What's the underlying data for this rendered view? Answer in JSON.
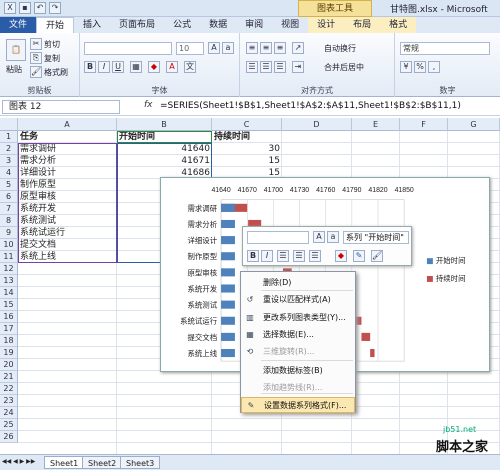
{
  "titlebar": {
    "context_tools": "图表工具",
    "doc_title": "甘特图.xlsx - Microsoft"
  },
  "tabs": [
    {
      "label": "文件",
      "kind": "file"
    },
    {
      "label": "开始",
      "kind": "active"
    },
    {
      "label": "插入",
      "kind": ""
    },
    {
      "label": "页面布局",
      "kind": ""
    },
    {
      "label": "公式",
      "kind": ""
    },
    {
      "label": "数据",
      "kind": ""
    },
    {
      "label": "审阅",
      "kind": ""
    },
    {
      "label": "视图",
      "kind": ""
    },
    {
      "label": "设计",
      "kind": "ctx"
    },
    {
      "label": "布局",
      "kind": "ctx"
    },
    {
      "label": "格式",
      "kind": "ctx"
    }
  ],
  "ribbon": {
    "paste": "粘贴",
    "cut": "剪切",
    "copy": "复制",
    "format_painter": "格式刷",
    "clipboard_group": "剪贴板",
    "font_size": "10",
    "font_group": "字体",
    "align_group": "对齐方式",
    "wrap": "自动换行",
    "merge": "合并后居中",
    "number_format": "常规",
    "number_group": "数字",
    "bold": "B",
    "italic": "I",
    "underline": "U"
  },
  "formula_bar": {
    "name_box": "图表 12",
    "fx": "fx",
    "formula": "=SERIES(Sheet1!$B$1,Sheet1!$A$2:$A$11,Sheet1!$B$2:$B$11,1)"
  },
  "columns": [
    "A",
    "B",
    "C",
    "D",
    "E",
    "F",
    "G"
  ],
  "rows": [
    "1",
    "2",
    "3",
    "4",
    "5",
    "6",
    "7",
    "8",
    "9",
    "10",
    "11",
    "12",
    "13",
    "14",
    "15",
    "16",
    "17",
    "18",
    "19",
    "20",
    "21",
    "22",
    "23",
    "24",
    "25",
    "26"
  ],
  "header": {
    "task": "任务",
    "start": "开始时间",
    "duration": "持续时间"
  },
  "tasks": [
    {
      "name": "需求调研",
      "start": "41640",
      "dur": "30"
    },
    {
      "name": "需求分析",
      "start": "41671",
      "dur": "15"
    },
    {
      "name": "详细设计",
      "start": "41686",
      "dur": "15"
    },
    {
      "name": "制作原型",
      "start": "",
      "dur": ""
    },
    {
      "name": "原型审核",
      "start": "",
      "dur": ""
    },
    {
      "name": "系统开发",
      "start": "",
      "dur": ""
    },
    {
      "name": "系统测试",
      "start": "",
      "dur": ""
    },
    {
      "name": "系统试运行",
      "start": "",
      "dur": ""
    },
    {
      "name": "提交文档",
      "start": "",
      "dur": ""
    },
    {
      "name": "系统上线",
      "start": "",
      "dur": ""
    }
  ],
  "chart_data": {
    "type": "bar",
    "categories": [
      "需求调研",
      "需求分析",
      "详细设计",
      "制作原型",
      "原型审核",
      "系统开发",
      "系统测试",
      "系统试运行",
      "提交文档",
      "系统上线"
    ],
    "x_ticks": [
      "41640",
      "41670",
      "41700",
      "41730",
      "41760",
      "41790",
      "41820",
      "41850"
    ],
    "xlim": [
      41640,
      41850
    ],
    "series": [
      {
        "name": "开始时间",
        "color": "#4f81bd",
        "values": [
          41640,
          41671,
          41686,
          41701,
          41711,
          41721,
          41781,
          41791,
          41801,
          41811
        ]
      },
      {
        "name": "持续时间",
        "color": "#c0504d",
        "values": [
          30,
          15,
          15,
          10,
          10,
          60,
          10,
          10,
          10,
          5
        ]
      }
    ],
    "legend_position": "right"
  },
  "mini_toolbar": {
    "series_select": "系列 \"开始时间\"",
    "bold": "B",
    "italic": "I"
  },
  "context_menu": [
    {
      "label": "删除(D)",
      "icon": "delete-icon",
      "glyph": "",
      "disabled": false,
      "hl": false
    },
    {
      "label": "重设以匹配样式(A)",
      "icon": "reset-style-icon",
      "glyph": "↺",
      "disabled": false,
      "hl": false
    },
    {
      "label": "更改系列图表类型(Y)...",
      "icon": "chart-type-icon",
      "glyph": "▥",
      "disabled": false,
      "hl": false
    },
    {
      "label": "选择数据(E)...",
      "icon": "select-data-icon",
      "glyph": "▦",
      "disabled": false,
      "hl": false
    },
    {
      "label": "三维旋转(R)...",
      "icon": "rotate-3d-icon",
      "glyph": "⟲",
      "disabled": true,
      "hl": false
    },
    {
      "label": "添加数据标签(B)",
      "icon": "",
      "glyph": "",
      "disabled": false,
      "hl": false
    },
    {
      "label": "添加趋势线(R)...",
      "icon": "",
      "glyph": "",
      "disabled": true,
      "hl": false
    },
    {
      "label": "设置数据系列格式(F)...",
      "icon": "format-series-icon",
      "glyph": "✎",
      "disabled": false,
      "hl": true
    }
  ],
  "sheets": [
    {
      "label": "Sheet1",
      "active": true
    },
    {
      "label": "Sheet2",
      "active": false
    },
    {
      "label": "Sheet3",
      "active": false
    }
  ],
  "watermark": {
    "url": "jb51.net",
    "name": "脚本之家"
  }
}
